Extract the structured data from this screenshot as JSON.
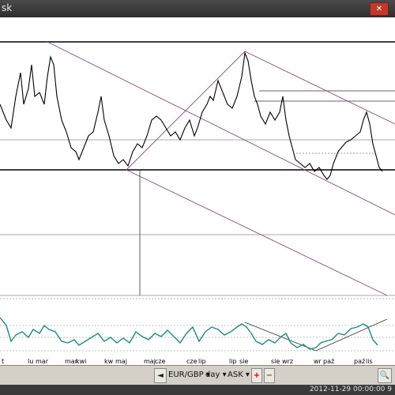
{
  "window": {
    "title": "sk",
    "close_glyph": "✕"
  },
  "chart": {
    "x_labels": [
      "t",
      "lu",
      "mar",
      "mar",
      "kwi",
      "kw",
      "maj",
      "maj",
      "cze",
      "cze",
      "lip",
      "lip",
      "sie",
      "sie",
      "wrz",
      "wr",
      "paź",
      "paź",
      "lis"
    ]
  },
  "toolbar": {
    "nav_left": "◄",
    "symbol": "EUR/GBP ▾",
    "period": "day ▾",
    "price_type": "ASK ▾",
    "plus": "+",
    "minus": "−",
    "zoom_in": "🔍"
  },
  "status": {
    "timestamp": "2012-11-29 00:00:00 9"
  },
  "colors": {
    "teal": "#1a8a8a",
    "trend": "#8a4a78",
    "bg": "#ffffff"
  }
}
